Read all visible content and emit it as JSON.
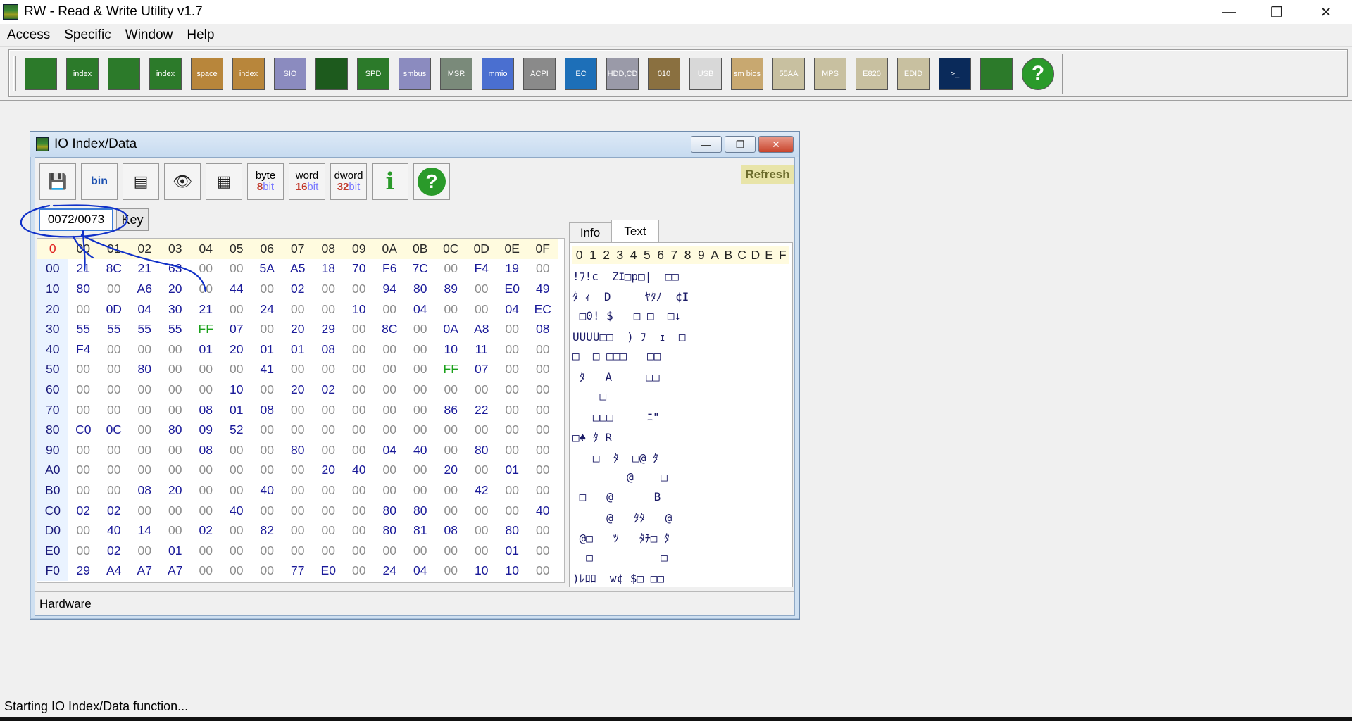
{
  "app": {
    "title": "RW - Read & Write Utility v1.7"
  },
  "window_controls": {
    "minimize": "—",
    "restore": "❐",
    "close": "✕"
  },
  "menu": [
    "Access",
    "Specific",
    "Window",
    "Help"
  ],
  "main_toolbar": {
    "tools": [
      {
        "name": "pci-icon",
        "label": "",
        "bg": "#2c7a2a"
      },
      {
        "name": "pci-index-icon",
        "label": "index",
        "bg": "#2c7a2a"
      },
      {
        "name": "memory-icon",
        "label": "",
        "bg": "#2c7a2a"
      },
      {
        "name": "memory-index-icon",
        "label": "index",
        "bg": "#2c7a2a"
      },
      {
        "name": "io-space-icon",
        "label": "space",
        "bg": "#b8863b"
      },
      {
        "name": "io-index-icon",
        "label": "index",
        "bg": "#b8863b"
      },
      {
        "name": "sio-icon",
        "label": "SIO",
        "bg": "#8b8bbf"
      },
      {
        "name": "oscilloscope-icon",
        "label": "",
        "bg": "#1d5a1d"
      },
      {
        "name": "spd-icon",
        "label": "SPD",
        "bg": "#2c7a2a"
      },
      {
        "name": "smbus-icon",
        "label": "smbus",
        "bg": "#8b8bbf"
      },
      {
        "name": "msr-icon",
        "label": "MSR",
        "bg": "#7a8a7a"
      },
      {
        "name": "mmio-icon",
        "label": "mmio",
        "bg": "#4a6fd0"
      },
      {
        "name": "acpi-icon",
        "label": "ACPI",
        "bg": "#8a8a8a"
      },
      {
        "name": "ec-icon",
        "label": "EC",
        "bg": "#1d6fb8"
      },
      {
        "name": "hdd-cd-icon",
        "label": "HDD,CD",
        "bg": "#9a9aa8"
      },
      {
        "name": "binary-disk-icon",
        "label": "010",
        "bg": "#8a7040"
      },
      {
        "name": "usb-icon",
        "label": "USB",
        "bg": "#d8d8d8"
      },
      {
        "name": "smbios-icon",
        "label": "sm bios",
        "bg": "#c8a870"
      },
      {
        "name": "55aa-icon",
        "label": "55AA",
        "bg": "#c8c0a0"
      },
      {
        "name": "mps-icon",
        "label": "MPS",
        "bg": "#c8c0a0"
      },
      {
        "name": "e820-icon",
        "label": "E820",
        "bg": "#c8c0a0"
      },
      {
        "name": "edid-icon",
        "label": "EDID",
        "bg": "#c8c0a0"
      },
      {
        "name": "command-prompt-icon",
        "label": ">_",
        "bg": "#0a2a5a"
      },
      {
        "name": "about-icon",
        "label": "",
        "bg": "#2c7a2a"
      },
      {
        "name": "help-icon",
        "label": "?",
        "bg": "#2a9a2a"
      }
    ]
  },
  "io_window": {
    "title": "IO Index/Data",
    "controls": {
      "minimize": "—",
      "restore": "❐",
      "close": "✕"
    },
    "refresh_label": "Refresh",
    "tools": [
      {
        "name": "save-icon",
        "glyph": "💾"
      },
      {
        "name": "save-binary-icon",
        "glyph": "bin"
      },
      {
        "name": "load-icon",
        "glyph": "▤"
      },
      {
        "name": "find-icon",
        "glyph": "👁"
      },
      {
        "name": "grid-icon",
        "glyph": "▦"
      },
      {
        "name": "byte-8bit-icon",
        "top": "byte",
        "bot": "8",
        "suffix": "bit"
      },
      {
        "name": "word-16bit-icon",
        "top": "word",
        "bot": "16",
        "suffix": "bit"
      },
      {
        "name": "dword-32bit-icon",
        "top": "dword",
        "bot": "32",
        "suffix": "bit"
      },
      {
        "name": "info-icon",
        "glyph": "i"
      },
      {
        "name": "help-icon",
        "glyph": "?"
      }
    ],
    "register_value": "0072/0073",
    "key_label": "Key",
    "hex": {
      "corner": "0",
      "cols": [
        "00",
        "01",
        "02",
        "03",
        "04",
        "05",
        "06",
        "07",
        "08",
        "09",
        "0A",
        "0B",
        "0C",
        "0D",
        "0E",
        "0F"
      ],
      "rows": [
        {
          "addr": "00",
          "cells": [
            "21",
            "8C",
            "21",
            "63",
            "00",
            "00",
            "5A",
            "A5",
            "18",
            "70",
            "F6",
            "7C",
            "00",
            "F4",
            "19",
            "00"
          ]
        },
        {
          "addr": "10",
          "cells": [
            "80",
            "00",
            "A6",
            "20",
            "00",
            "44",
            "00",
            "02",
            "00",
            "00",
            "94",
            "80",
            "89",
            "00",
            "E0",
            "49"
          ]
        },
        {
          "addr": "20",
          "cells": [
            "00",
            "0D",
            "04",
            "30",
            "21",
            "00",
            "24",
            "00",
            "00",
            "10",
            "00",
            "04",
            "00",
            "00",
            "04",
            "EC"
          ]
        },
        {
          "addr": "30",
          "cells": [
            "55",
            "55",
            "55",
            "55",
            "FF",
            "07",
            "00",
            "20",
            "29",
            "00",
            "8C",
            "00",
            "0A",
            "A8",
            "00",
            "08"
          ]
        },
        {
          "addr": "40",
          "cells": [
            "F4",
            "00",
            "00",
            "00",
            "01",
            "20",
            "01",
            "01",
            "08",
            "00",
            "00",
            "00",
            "10",
            "11",
            "00",
            "00"
          ]
        },
        {
          "addr": "50",
          "cells": [
            "00",
            "00",
            "80",
            "00",
            "00",
            "00",
            "41",
            "00",
            "00",
            "00",
            "00",
            "00",
            "FF",
            "07",
            "00",
            "00"
          ]
        },
        {
          "addr": "60",
          "cells": [
            "00",
            "00",
            "00",
            "00",
            "00",
            "10",
            "00",
            "20",
            "02",
            "00",
            "00",
            "00",
            "00",
            "00",
            "00",
            "00"
          ]
        },
        {
          "addr": "70",
          "cells": [
            "00",
            "00",
            "00",
            "00",
            "08",
            "01",
            "08",
            "00",
            "00",
            "00",
            "00",
            "00",
            "86",
            "22",
            "00",
            "00"
          ]
        },
        {
          "addr": "80",
          "cells": [
            "C0",
            "0C",
            "00",
            "80",
            "09",
            "52",
            "00",
            "00",
            "00",
            "00",
            "00",
            "00",
            "00",
            "00",
            "00",
            "00"
          ]
        },
        {
          "addr": "90",
          "cells": [
            "00",
            "00",
            "00",
            "00",
            "08",
            "00",
            "00",
            "80",
            "00",
            "00",
            "04",
            "40",
            "00",
            "80",
            "00",
            "00"
          ]
        },
        {
          "addr": "A0",
          "cells": [
            "00",
            "00",
            "00",
            "00",
            "00",
            "00",
            "00",
            "00",
            "20",
            "40",
            "00",
            "00",
            "20",
            "00",
            "01",
            "00"
          ]
        },
        {
          "addr": "B0",
          "cells": [
            "00",
            "00",
            "08",
            "20",
            "00",
            "00",
            "40",
            "00",
            "00",
            "00",
            "00",
            "00",
            "00",
            "42",
            "00",
            "00"
          ]
        },
        {
          "addr": "C0",
          "cells": [
            "02",
            "02",
            "00",
            "00",
            "00",
            "40",
            "00",
            "00",
            "00",
            "00",
            "80",
            "80",
            "00",
            "00",
            "00",
            "40"
          ]
        },
        {
          "addr": "D0",
          "cells": [
            "00",
            "40",
            "14",
            "00",
            "02",
            "00",
            "82",
            "00",
            "00",
            "00",
            "80",
            "81",
            "08",
            "00",
            "80",
            "00"
          ]
        },
        {
          "addr": "E0",
          "cells": [
            "00",
            "02",
            "00",
            "01",
            "00",
            "00",
            "00",
            "00",
            "00",
            "00",
            "00",
            "00",
            "00",
            "00",
            "01",
            "00"
          ]
        },
        {
          "addr": "F0",
          "cells": [
            "29",
            "A4",
            "A7",
            "A7",
            "00",
            "00",
            "00",
            "77",
            "E0",
            "00",
            "24",
            "04",
            "00",
            "10",
            "10",
            "00"
          ]
        }
      ]
    },
    "tabs": [
      "Info",
      "Text"
    ],
    "text_header": [
      "0",
      "1",
      "2",
      "3",
      "4",
      "5",
      "6",
      "7",
      "8",
      "9",
      "A",
      "B",
      "C",
      "D",
      "E",
      "F"
    ],
    "text_rows": [
      "!ﾌ!c  Zｴ□p□|  □□",
      "ﾀ ｨ  D     ﾔﾀﾉ  ¢I",
      " □0! $   □ □  □↓",
      "UUUU□□  ) ﾌ  ｪ  □",
      "□  □ □□□   □□",
      " ﾀ   A     □□",
      "    □",
      "   □□□     ﾆ\"",
      "□♠ ﾀ R",
      "   □  ﾀ  □@ ﾀ",
      "        @    □",
      " □   @      B",
      "     @   ﾀﾀ   @",
      " @□   ﾂ   ﾀﾁ□ ﾀ",
      "  □          □",
      ")ﾚﾛﾛ  w¢ $□ □□"
    ],
    "status_left": "Hardware"
  },
  "status_bar": {
    "text": "Starting IO Index/Data function..."
  }
}
